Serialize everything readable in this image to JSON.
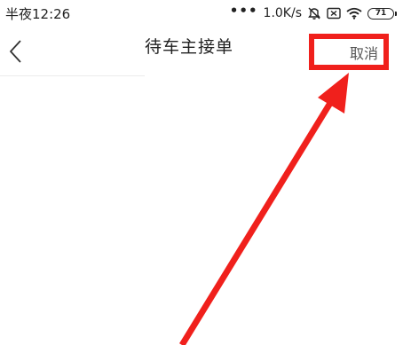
{
  "status_bar": {
    "time": "半夜12:26",
    "dots": "•••",
    "network_speed": "1.0K/s",
    "battery_level": "71"
  },
  "nav": {
    "title": "待车主接单",
    "cancel_label": "取消"
  },
  "annotation": {
    "color": "#f0201c"
  }
}
